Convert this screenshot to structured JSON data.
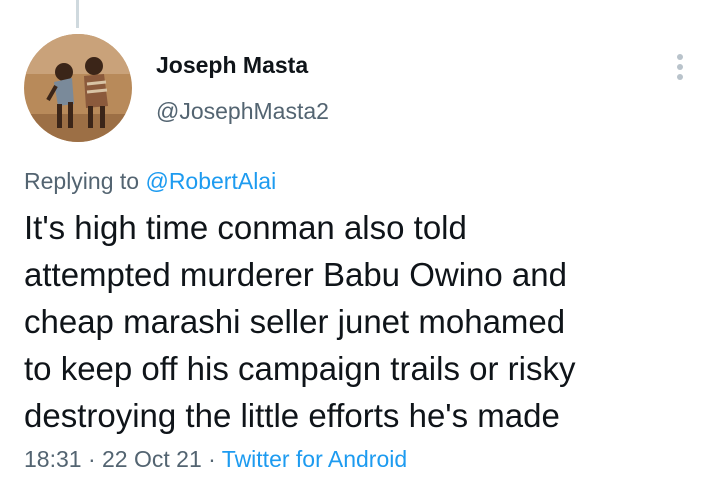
{
  "tweet": {
    "author": {
      "name": "Joseph Masta",
      "handle": "@JosephMasta2"
    },
    "reply": {
      "prefix": "Replying to",
      "mention": "@RobertAlai"
    },
    "text_lines": [
      "It's high time conman also told",
      "attempted murderer Babu Owino and",
      "cheap marashi seller junet mohamed",
      "to keep off his campaign trails or risky",
      "destroying the little efforts he's made"
    ],
    "meta": {
      "time": "18:31",
      "separator": "·",
      "date": "22 Oct 21",
      "source": "Twitter for Android"
    },
    "colors": {
      "accent": "#1d9bf0",
      "secondary_text": "#536471",
      "primary_text": "#0f1419"
    },
    "icons": {
      "more": "more-vertical-icon"
    }
  }
}
